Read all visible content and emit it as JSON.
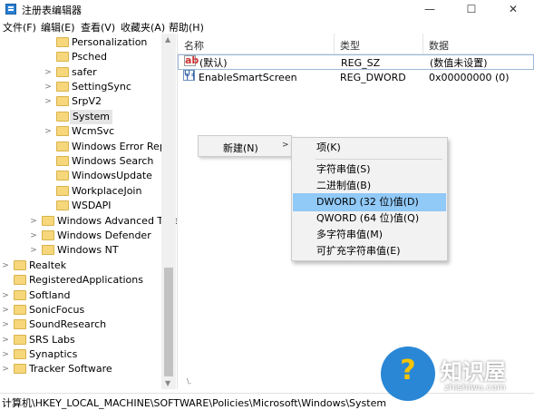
{
  "window": {
    "title": "注册表编辑器",
    "minimize_glyph": "—",
    "maximize_glyph": "☐",
    "close_glyph": "✕"
  },
  "menu": [
    "文件(F)",
    "编辑(E)",
    "查看(V)",
    "收藏夹(A)",
    "帮助(H)"
  ],
  "tree": {
    "items": [
      {
        "label": "Personalization",
        "arrow": ""
      },
      {
        "label": "Psched",
        "arrow": ""
      },
      {
        "label": "safer",
        "arrow": ">"
      },
      {
        "label": "SettingSync",
        "arrow": ">"
      },
      {
        "label": "SrpV2",
        "arrow": ">"
      },
      {
        "label": "System",
        "arrow": "",
        "selected": true
      },
      {
        "label": "WcmSvc",
        "arrow": ">"
      },
      {
        "label": "Windows Error Repo",
        "arrow": ""
      },
      {
        "label": "Windows Search",
        "arrow": ""
      },
      {
        "label": "WindowsUpdate",
        "arrow": ""
      },
      {
        "label": "WorkplaceJoin",
        "arrow": ""
      },
      {
        "label": "WSDAPI",
        "arrow": ""
      },
      {
        "label": "Windows Advanced Thre",
        "arrow": ">"
      },
      {
        "label": "Windows Defender",
        "arrow": ">"
      },
      {
        "label": "Windows NT",
        "arrow": ">"
      },
      {
        "label": "Realtek",
        "arrow": ">"
      },
      {
        "label": "RegisteredApplications",
        "arrow": ""
      },
      {
        "label": "Softland",
        "arrow": ">"
      },
      {
        "label": "SonicFocus",
        "arrow": ">"
      },
      {
        "label": "SoundResearch",
        "arrow": ">"
      },
      {
        "label": "SRS Labs",
        "arrow": ">"
      },
      {
        "label": "Synaptics",
        "arrow": ">"
      },
      {
        "label": "Tracker Software",
        "arrow": ">"
      }
    ]
  },
  "list": {
    "headers": {
      "name": "名称",
      "type": "类型",
      "data": "数据"
    },
    "rows": [
      {
        "icon": "ab",
        "name": "(默认)",
        "type": "REG_SZ",
        "data": "(数值未设置)"
      },
      {
        "icon": "bin",
        "name": "EnableSmartScreen",
        "type": "REG_DWORD",
        "data": "0x00000000 (0)"
      }
    ]
  },
  "context_menu": {
    "new_label": "新建(N)",
    "submenu_arrow": ">",
    "items": [
      {
        "label": "项(K)"
      },
      {
        "label": "字符串值(S)"
      },
      {
        "label": "二进制值(B)"
      },
      {
        "label": "DWORD (32 位)值(D)",
        "highlighted": true
      },
      {
        "label": "QWORD (64 位)值(Q)"
      },
      {
        "label": "多字符串值(M)"
      },
      {
        "label": "可扩充字符串值(E)"
      }
    ]
  },
  "status": {
    "path": "计算机\\HKEY_LOCAL_MACHINE\\SOFTWARE\\Policies\\Microsoft\\Windows\\System"
  },
  "watermark": {
    "title": "知识屋",
    "subtitle": "zhishiwu.com",
    "logo_glyph": "?"
  },
  "colors": {
    "highlight": "#91c9f7",
    "folder": "#f6d77c",
    "logo": "#2a87d6"
  }
}
